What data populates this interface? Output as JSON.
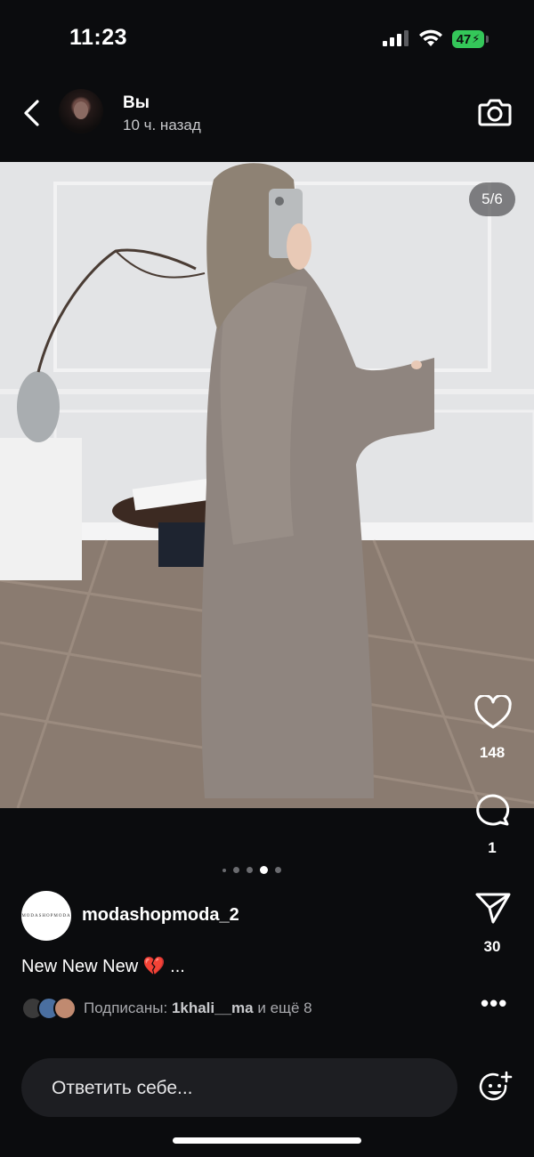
{
  "status_bar": {
    "time": "11:23",
    "battery": "47"
  },
  "story": {
    "author": "Вы",
    "posted_ago": "10 ч. назад",
    "slide_counter": "5/6",
    "current_slide": 5,
    "total_slides": 6
  },
  "actions": {
    "likes": "148",
    "comments": "1",
    "shares": "30"
  },
  "post": {
    "account": "modashopmoda_2",
    "logo_text": "MODASHOPMODA",
    "caption": "New New New 💔 ...",
    "followers_prefix": "Подписаны: ",
    "followers_name": "1khali__ma",
    "followers_suffix": " и ещё 8"
  },
  "reply": {
    "placeholder": "Ответить себе..."
  },
  "colors": {
    "background": "#0b0c0e",
    "battery": "#34c759",
    "reply_bg": "#1d1e22"
  },
  "icons": [
    "back-chevron",
    "camera",
    "heart",
    "comment-bubble",
    "send-paper-plane",
    "more-dots",
    "add-emoji"
  ]
}
